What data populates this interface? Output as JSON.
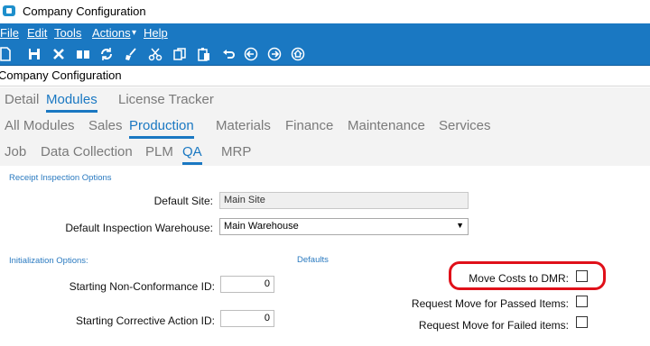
{
  "window": {
    "title": "Company Configuration"
  },
  "menu": {
    "file": "File",
    "edit": "Edit",
    "tools": "Tools",
    "actions": "Actions",
    "actions_caret": "▾",
    "help": "Help"
  },
  "toolbar": {
    "icons": [
      "new-icon",
      "save-icon",
      "delete-icon",
      "book-icon",
      "refresh-icon",
      "clear-icon",
      "cut-icon",
      "copy-icon",
      "paste-icon",
      "undo-icon",
      "back-icon",
      "forward-icon",
      "home-icon"
    ]
  },
  "form": {
    "title": "Company Configuration"
  },
  "tabs_top": [
    "Detail",
    "Modules",
    "License Tracker"
  ],
  "tabs_modules": [
    "All Modules",
    "Sales",
    "Production",
    "Materials",
    "Finance",
    "Maintenance",
    "Services"
  ],
  "tabs_production": [
    "Job",
    "Data Collection",
    "PLM",
    "QA",
    "MRP"
  ],
  "receipt": {
    "section": "Receipt Inspection Options",
    "default_site_label": "Default Site:",
    "default_site_value": "Main Site",
    "warehouse_label": "Default Inspection Warehouse:",
    "warehouse_value": "Main Warehouse"
  },
  "init": {
    "section": "Initialization Options:",
    "ncr_label": "Starting Non-Conformance ID:",
    "ncr_value": "0",
    "car_label": "Starting Corrective Action ID:",
    "car_value": "0"
  },
  "defaults": {
    "section": "Defaults",
    "move_costs_label": "Move Costs to DMR:",
    "move_costs_checked": false,
    "passed_label": "Request Move for Passed Items:",
    "passed_checked": false,
    "failed_label": "Request Move for Failed items:",
    "failed_checked": false
  },
  "colors": {
    "accent": "#1a78c2",
    "highlight": "#e01019",
    "section": "#2a7ac0"
  }
}
